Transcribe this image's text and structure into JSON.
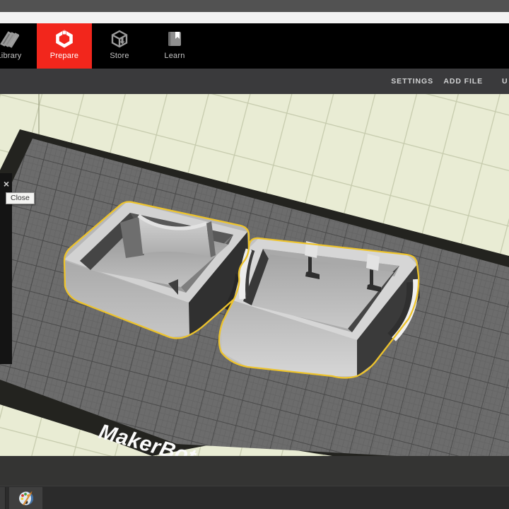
{
  "nav": {
    "active_bg": "#f2261c",
    "items": [
      {
        "id": "library",
        "label": "Library",
        "active": false
      },
      {
        "id": "prepare",
        "label": "Prepare",
        "active": true
      },
      {
        "id": "store",
        "label": "Store",
        "active": false
      },
      {
        "id": "learn",
        "label": "Learn",
        "active": false
      }
    ]
  },
  "menubar": {
    "items": [
      {
        "label": "SETTINGS"
      },
      {
        "label": "ADD FILE"
      },
      {
        "label": "U"
      }
    ]
  },
  "viewport": {
    "close": {
      "icon": "×",
      "tooltip": "Close"
    },
    "plate": {
      "brand": "MakerBot",
      "trademark": "™"
    },
    "selection_color": "#edc32c",
    "floor_color": "#e9ecd4",
    "plate_color": "#6c6c6c",
    "models": [
      {
        "selected": true
      },
      {
        "selected": true
      }
    ]
  },
  "taskbar": {
    "app_icon": "paint-palette-icon"
  }
}
